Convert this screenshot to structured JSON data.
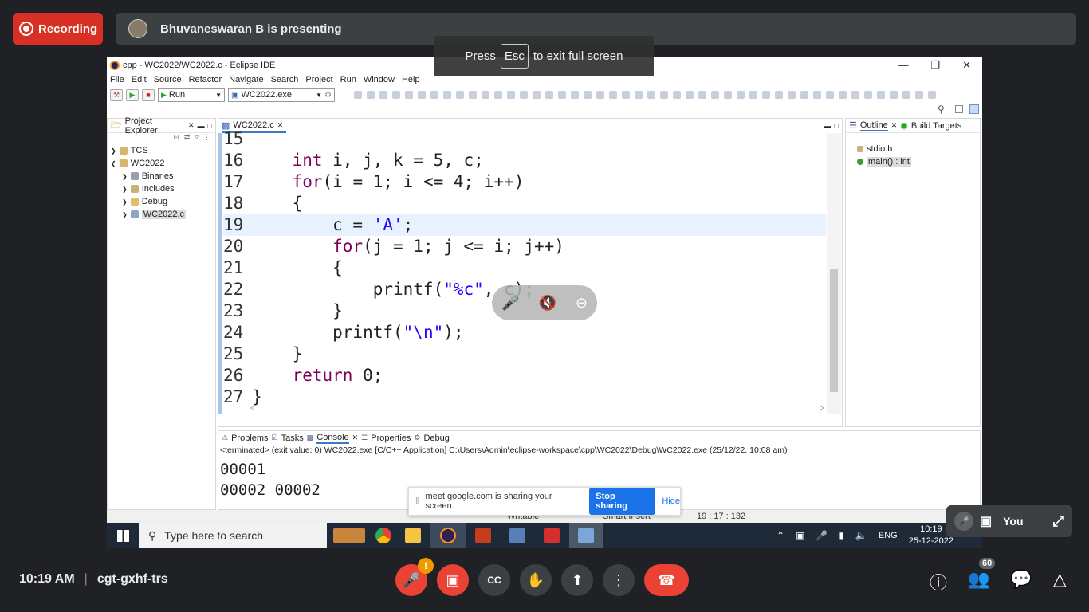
{
  "meet": {
    "recording_label": "Recording",
    "presenter_text": "Bhuvaneswaran B is presenting",
    "fullscreen": {
      "press": "Press",
      "key": "Esc",
      "rest": "to exit full screen"
    },
    "time": "10:19 AM",
    "meeting_code": "cgt-gxhf-trs",
    "self_label": "You",
    "participants_count": "60",
    "mic_warning_badge": "!",
    "share_bar": {
      "text": "meet.google.com is sharing your screen.",
      "stop": "Stop sharing",
      "hide": "Hide"
    },
    "accent": "#d93025"
  },
  "eclipse": {
    "title": "cpp - WC2022/WC2022.c - Eclipse IDE",
    "menu": [
      "File",
      "Edit",
      "Source",
      "Refactor",
      "Navigate",
      "Search",
      "Project",
      "Run",
      "Window",
      "Help"
    ],
    "run_combo": "Run",
    "target_combo": "WC2022.exe",
    "project_explorer": {
      "tab": "Project Explorer",
      "items": [
        "TCS",
        "WC2022",
        "Binaries",
        "Includes",
        "Debug",
        "WC2022.c"
      ]
    },
    "editor": {
      "tab": "WC2022.c",
      "lines": [
        {
          "n": "15",
          "t": ""
        },
        {
          "n": "16",
          "t": "    int i, j, k = 5, c;"
        },
        {
          "n": "17",
          "t": "    for(i = 1; i <= 4; i++)"
        },
        {
          "n": "18",
          "t": "    {"
        },
        {
          "n": "19",
          "t": "        c = 'A';"
        },
        {
          "n": "20",
          "t": "        for(j = 1; j <= i; j++)"
        },
        {
          "n": "21",
          "t": "        {"
        },
        {
          "n": "22",
          "t": "            printf(\"%c\", c);"
        },
        {
          "n": "23",
          "t": "        }"
        },
        {
          "n": "24",
          "t": "        printf(\"\\n\");"
        },
        {
          "n": "25",
          "t": "    }"
        },
        {
          "n": "26",
          "t": "    return 0;"
        },
        {
          "n": "27",
          "t": "}"
        }
      ]
    },
    "outline": {
      "tab_outline": "Outline",
      "tab_build": "Build Targets",
      "items": [
        "stdio.h",
        "main() : int"
      ]
    },
    "bottom_tabs": [
      "Problems",
      "Tasks",
      "Console",
      "Properties",
      "Debug"
    ],
    "console": {
      "header": "<terminated> (exit value: 0) WC2022.exe [C/C++ Application] C:\\Users\\Admin\\eclipse-workspace\\cpp\\WC2022\\Debug\\WC2022.exe (25/12/22, 10:08 am)",
      "lines": [
        "00001",
        "00002 00002"
      ]
    },
    "status": {
      "writable": "Writable",
      "insert": "Smart Insert",
      "pos": "19 : 17 : 132"
    }
  },
  "windows": {
    "search_placeholder": "Type here to search",
    "lang": "ENG",
    "time": "10:19",
    "date": "25-12-2022"
  }
}
